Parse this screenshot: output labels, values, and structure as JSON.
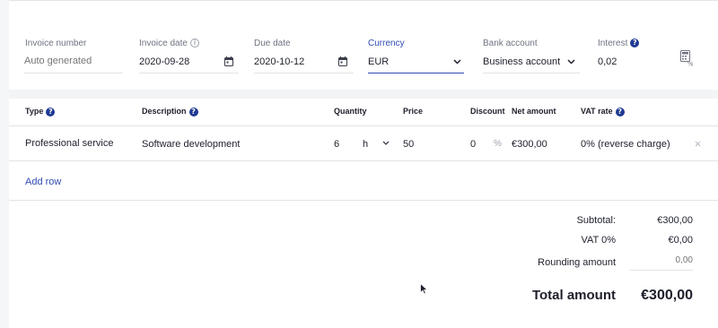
{
  "header_fields": {
    "invoice_number": {
      "label": "Invoice number",
      "placeholder": "Auto generated"
    },
    "invoice_date": {
      "label": "Invoice date",
      "value": "2020-09-28",
      "icon": "calendar-icon"
    },
    "due_date": {
      "label": "Due date",
      "value": "2020-10-12",
      "icon": "calendar-icon"
    },
    "currency": {
      "label": "Currency",
      "value": "EUR",
      "icon": "chevron-down-icon"
    },
    "bank_account": {
      "label": "Bank account",
      "value": "Business account",
      "icon": "chevron-down-icon"
    },
    "interest": {
      "label": "Interest",
      "value": "0,02",
      "icon": "calculator-percent-icon"
    }
  },
  "table": {
    "headers": {
      "type": "Type",
      "description": "Description",
      "quantity": "Quantity",
      "price": "Price",
      "discount": "Discount",
      "net_amount": "Net amount",
      "vat_rate": "VAT rate"
    },
    "rows": [
      {
        "type": "Professional service",
        "description": "Software development",
        "quantity": "6",
        "unit": "h",
        "price": "50",
        "discount": "0",
        "discount_unit": "%",
        "net_amount": "€300,00",
        "vat_rate": "0% (reverse charge)"
      }
    ],
    "add_row_label": "Add row"
  },
  "totals": {
    "subtotal_label": "Subtotal:",
    "subtotal_value": "€300,00",
    "vat_label": "VAT 0%",
    "vat_value": "€0,00",
    "rounding_label": "Rounding amount",
    "rounding_placeholder": "0,00",
    "total_label": "Total amount",
    "total_value": "€300,00"
  },
  "colors": {
    "accent": "#2f4bb3",
    "help_icon": "#1f3a93",
    "text": "#1d1f2b",
    "muted": "#6f7380"
  }
}
